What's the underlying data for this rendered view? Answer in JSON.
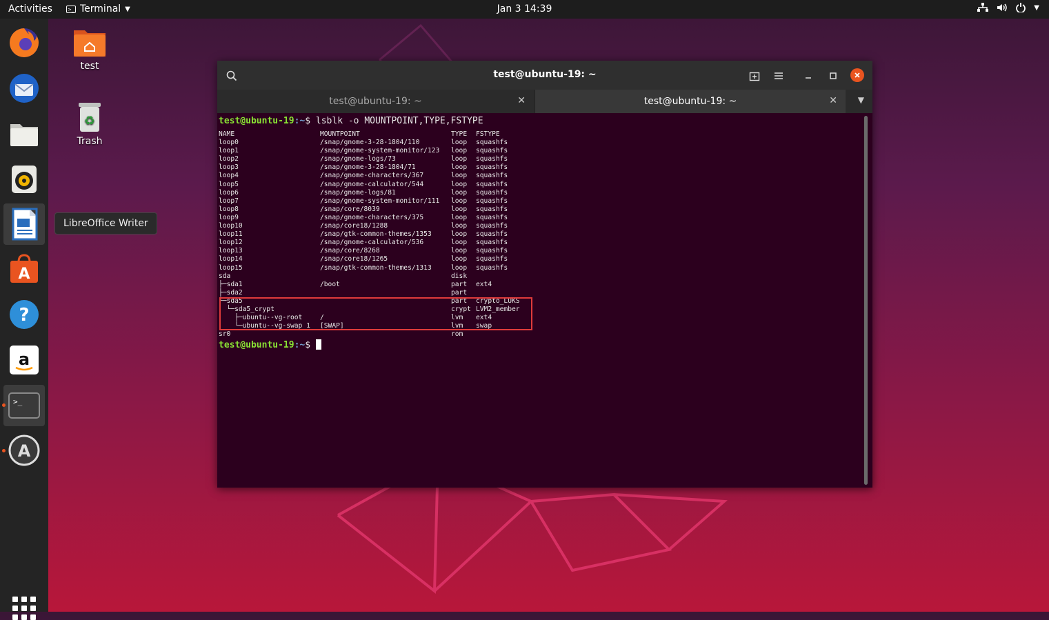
{
  "topbar": {
    "activities": "Activities",
    "app_name": "Terminal",
    "clock": "Jan 3  14:39"
  },
  "dock": {
    "apps": [
      "firefox",
      "thunderbird",
      "files",
      "rhythmbox",
      "libreoffice-writer",
      "ubuntu-software",
      "help",
      "amazon",
      "terminal",
      "software-updater"
    ],
    "show_apps": "show-applications"
  },
  "tooltip": "LibreOffice Writer",
  "desktop": {
    "home_label": "test",
    "trash_label": "Trash"
  },
  "window": {
    "title": "test@ubuntu-19: ~",
    "tabs": [
      {
        "label": "test@ubuntu-19: ~",
        "active": false
      },
      {
        "label": "test@ubuntu-19: ~",
        "active": true
      }
    ]
  },
  "terminal": {
    "prompt_user": "test@ubuntu-19",
    "prompt_path": ":~",
    "prompt_symbol": "$",
    "command": " lsblk -o MOUNTPOINT,TYPE,FSTYPE",
    "header": {
      "name": "NAME",
      "mountpoint": "MOUNTPOINT",
      "type": "TYPE",
      "fstype": "FSTYPE"
    },
    "rows": [
      {
        "name": "loop0",
        "mountpoint": "/snap/gnome-3-28-1804/110",
        "type": "loop",
        "fstype": "squashfs"
      },
      {
        "name": "loop1",
        "mountpoint": "/snap/gnome-system-monitor/123",
        "type": "loop",
        "fstype": "squashfs"
      },
      {
        "name": "loop2",
        "mountpoint": "/snap/gnome-logs/73",
        "type": "loop",
        "fstype": "squashfs"
      },
      {
        "name": "loop3",
        "mountpoint": "/snap/gnome-3-28-1804/71",
        "type": "loop",
        "fstype": "squashfs"
      },
      {
        "name": "loop4",
        "mountpoint": "/snap/gnome-characters/367",
        "type": "loop",
        "fstype": "squashfs"
      },
      {
        "name": "loop5",
        "mountpoint": "/snap/gnome-calculator/544",
        "type": "loop",
        "fstype": "squashfs"
      },
      {
        "name": "loop6",
        "mountpoint": "/snap/gnome-logs/81",
        "type": "loop",
        "fstype": "squashfs"
      },
      {
        "name": "loop7",
        "mountpoint": "/snap/gnome-system-monitor/111",
        "type": "loop",
        "fstype": "squashfs"
      },
      {
        "name": "loop8",
        "mountpoint": "/snap/core/8039",
        "type": "loop",
        "fstype": "squashfs"
      },
      {
        "name": "loop9",
        "mountpoint": "/snap/gnome-characters/375",
        "type": "loop",
        "fstype": "squashfs"
      },
      {
        "name": "loop10",
        "mountpoint": "/snap/core18/1288",
        "type": "loop",
        "fstype": "squashfs"
      },
      {
        "name": "loop11",
        "mountpoint": "/snap/gtk-common-themes/1353",
        "type": "loop",
        "fstype": "squashfs"
      },
      {
        "name": "loop12",
        "mountpoint": "/snap/gnome-calculator/536",
        "type": "loop",
        "fstype": "squashfs"
      },
      {
        "name": "loop13",
        "mountpoint": "/snap/core/8268",
        "type": "loop",
        "fstype": "squashfs"
      },
      {
        "name": "loop14",
        "mountpoint": "/snap/core18/1265",
        "type": "loop",
        "fstype": "squashfs"
      },
      {
        "name": "loop15",
        "mountpoint": "/snap/gtk-common-themes/1313",
        "type": "loop",
        "fstype": "squashfs"
      },
      {
        "name": "sda",
        "mountpoint": "",
        "type": "disk",
        "fstype": ""
      },
      {
        "name": "├─sda1",
        "mountpoint": "/boot",
        "type": "part",
        "fstype": "ext4"
      },
      {
        "name": "├─sda2",
        "mountpoint": "",
        "type": "part",
        "fstype": ""
      },
      {
        "name": "└─sda5",
        "mountpoint": "",
        "type": "part",
        "fstype": "crypto_LUKS"
      },
      {
        "name": "  └─sda5_crypt",
        "mountpoint": "",
        "type": "crypt",
        "fstype": "LVM2_member"
      },
      {
        "name": "    ├─ubuntu--vg-root",
        "mountpoint": "/",
        "type": "lvm",
        "fstype": "ext4"
      },
      {
        "name": "    └─ubuntu--vg-swap_1",
        "mountpoint": "[SWAP]",
        "type": "lvm",
        "fstype": "swap"
      },
      {
        "name": "sr0",
        "mountpoint": "",
        "type": "rom",
        "fstype": ""
      }
    ]
  },
  "colors": {
    "accent": "#e95420",
    "terminal_bg": "#2c001e",
    "prompt_user": "#8ae234",
    "prompt_path": "#729fcf",
    "highlight_box": "#e03b3b"
  }
}
